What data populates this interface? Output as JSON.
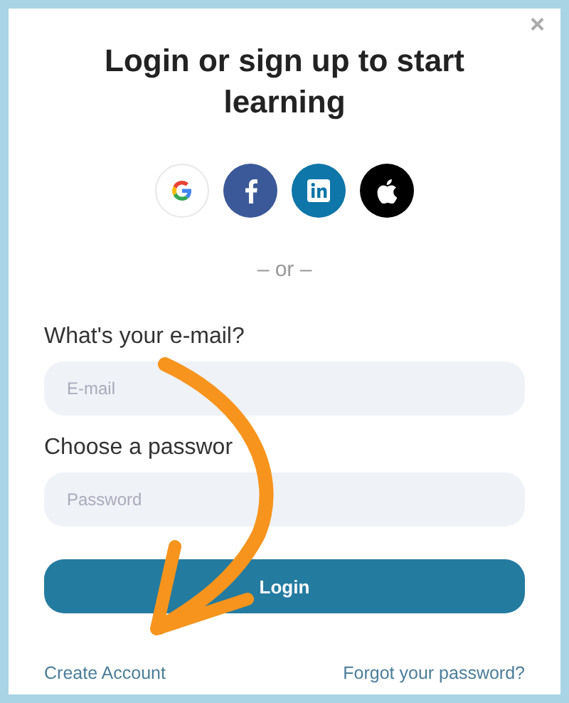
{
  "close": "×",
  "title": "Login or sign up to start learning",
  "social_buttons": [
    {
      "kind": "google"
    },
    {
      "kind": "facebook"
    },
    {
      "kind": "linkedin"
    },
    {
      "kind": "apple"
    }
  ],
  "divider": "– or –",
  "email": {
    "label": "What's your e-mail?",
    "placeholder": "E-mail"
  },
  "password": {
    "label": "Choose a passwor",
    "placeholder": "Password"
  },
  "login_button": "Login",
  "links": [
    "Create Account",
    "Forgot your password?"
  ]
}
